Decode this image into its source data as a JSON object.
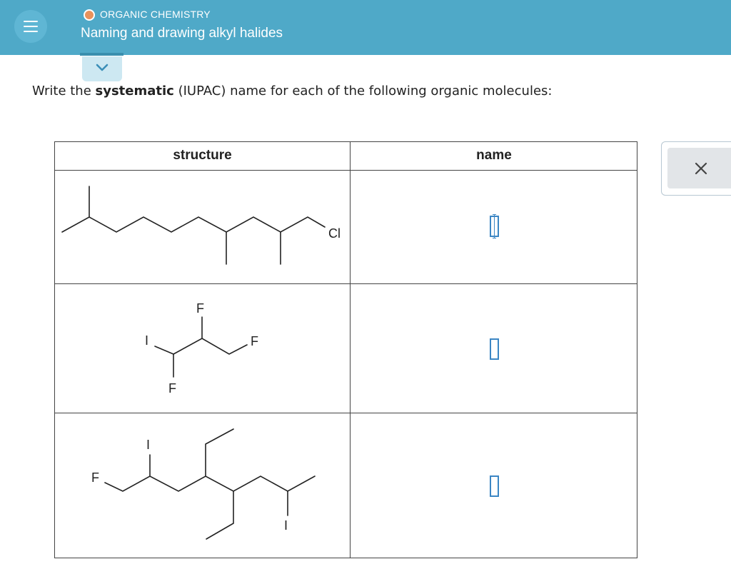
{
  "header": {
    "topic": "ORGANIC CHEMISTRY",
    "title": "Naming and drawing alkyl halides",
    "topic_dot_color": "#e8925c",
    "bar_color": "#4fa9c8"
  },
  "question": {
    "prefix": "Write the ",
    "bold": "systematic",
    "suffix": " (IUPAC) name for each of the following organic molecules:"
  },
  "table": {
    "col_structure": "structure",
    "col_name": "name",
    "rows": [
      {
        "atoms": [
          "Cl"
        ],
        "answer": ""
      },
      {
        "atoms": [
          "F",
          "I",
          "F",
          "F"
        ],
        "answer": ""
      },
      {
        "atoms": [
          "F",
          "I",
          "I"
        ],
        "answer": ""
      }
    ]
  },
  "icons": {
    "menu": "hamburger-icon",
    "expand": "chevron-down-icon",
    "clear": "close-icon"
  }
}
